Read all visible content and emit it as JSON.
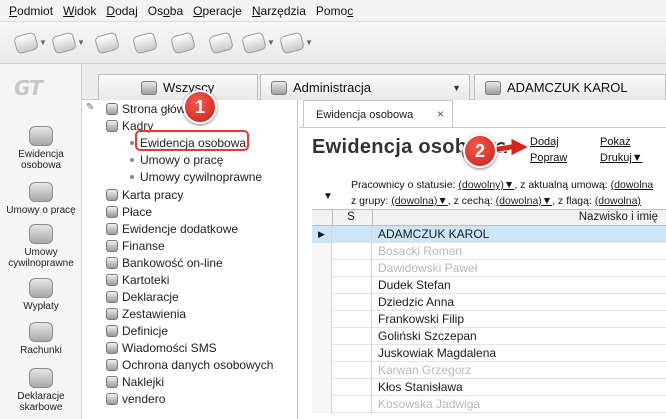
{
  "menu": [
    {
      "pre": "",
      "u": "P",
      "post": "odmiot"
    },
    {
      "pre": "",
      "u": "W",
      "post": "idok"
    },
    {
      "pre": "",
      "u": "D",
      "post": "odaj"
    },
    {
      "pre": "Os",
      "u": "o",
      "post": "ba"
    },
    {
      "pre": "",
      "u": "O",
      "post": "peracje"
    },
    {
      "pre": "",
      "u": "N",
      "post": "arzędzia"
    },
    {
      "pre": "Pomo",
      "u": "c",
      "post": ""
    }
  ],
  "logo": "GT",
  "leftnav": [
    "Ewidencja osobowa",
    "Umowy o pracę",
    "Umowy cywilnoprawne",
    "Wypłaty",
    "Rachunki",
    "Deklaracje skarbowe"
  ],
  "tabs": [
    {
      "label": "Wszyscy"
    },
    {
      "label": "Administracja"
    },
    {
      "label": "ADAMCZUK KAROL"
    }
  ],
  "tree": [
    {
      "label": "Strona główna"
    },
    {
      "label": "Kadry"
    },
    {
      "label": "Ewidencja osobowa"
    },
    {
      "label": "Umowy o pracę"
    },
    {
      "label": "Umowy cywilnoprawne"
    },
    {
      "label": "Karta pracy"
    },
    {
      "label": "Płace"
    },
    {
      "label": "Ewidencje dodatkowe"
    },
    {
      "label": "Finanse"
    },
    {
      "label": "Bankowość on-line"
    },
    {
      "label": "Kartoteki"
    },
    {
      "label": "Deklaracje"
    },
    {
      "label": "Zestawienia"
    },
    {
      "label": "Definicje"
    },
    {
      "label": "Wiadomości SMS"
    },
    {
      "label": "Ochrona danych osobowych"
    },
    {
      "label": "Naklejki"
    },
    {
      "label": "vendero"
    }
  ],
  "content": {
    "tab_label": "Ewidencja osobowa",
    "tab_close": "×",
    "title": "Ewidencja osobowa",
    "links": {
      "dodaj": "Dodaj",
      "popraw": "Popraw",
      "pokaz": "Pokaż",
      "drukuj": "Drukuj"
    },
    "filters": {
      "row1_label": "Pracownicy o statusie:",
      "row1_val": "(dowolny)",
      "row1_sep": ", z aktualną umową:",
      "row1_val2": "(dowolna",
      "row2_label": "z grupy:",
      "row2_val": "(dowolna)",
      "row2_sep": ", z cechą:",
      "row2_val2": "(dowolna)",
      "row2_sep2": ", z flagą:",
      "row2_val3": "(dowolna)"
    },
    "columns": [
      "S",
      "Nazwisko i imię"
    ],
    "rows": [
      {
        "name": "ADAMCZUK KAROL",
        "selected": true,
        "dim": false
      },
      {
        "name": "Bosacki Roman",
        "selected": false,
        "dim": true
      },
      {
        "name": "Dawidowski Paweł",
        "selected": false,
        "dim": true
      },
      {
        "name": "Dudek Stefan",
        "selected": false,
        "dim": false
      },
      {
        "name": "Dziedzic Anna",
        "selected": false,
        "dim": false
      },
      {
        "name": "Frankowski Filip",
        "selected": false,
        "dim": false
      },
      {
        "name": "Goliński Szczepan",
        "selected": false,
        "dim": false
      },
      {
        "name": "Juskowiak Magdalena",
        "selected": false,
        "dim": false
      },
      {
        "name": "Karwan Grzegorz",
        "selected": false,
        "dim": true
      },
      {
        "name": "Kłos Stanisława",
        "selected": false,
        "dim": false
      },
      {
        "name": "Kosowska Jadwiga",
        "selected": false,
        "dim": true
      }
    ]
  },
  "callouts": [
    "1",
    "2"
  ],
  "colors": {
    "accent": "#e03a3a",
    "selection": "#cde6f7"
  }
}
